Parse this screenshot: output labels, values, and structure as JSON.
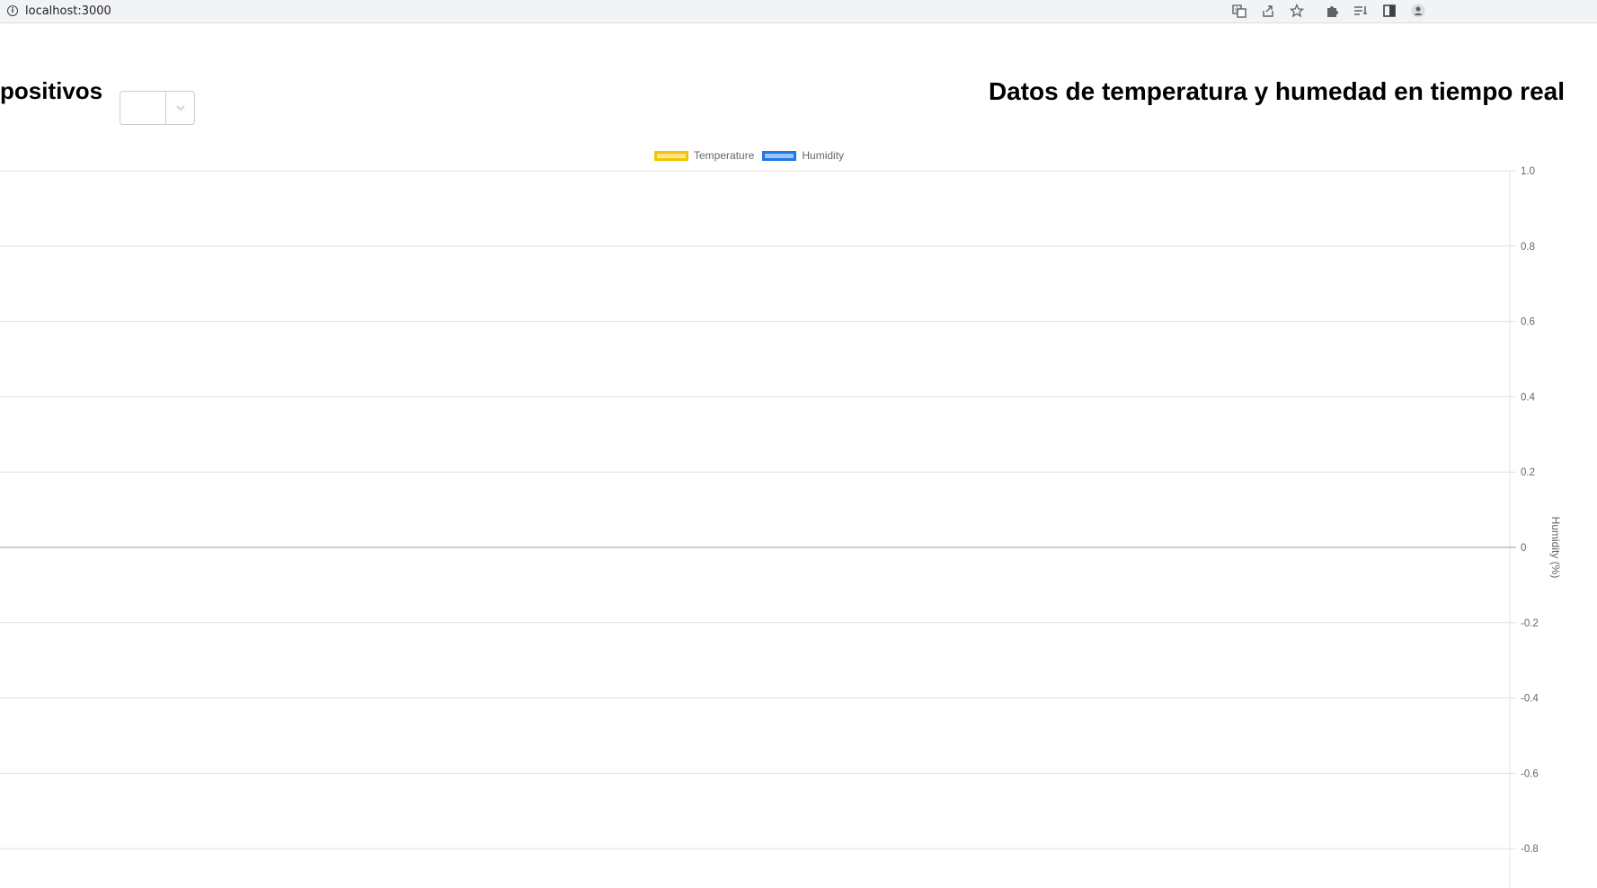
{
  "browser": {
    "url": "localhost:3000",
    "toolbar_icons": [
      "translate-icon",
      "share-icon",
      "bookmark-star-icon",
      "extensions-icon",
      "reading-list-icon",
      "side-panel-icon",
      "profile-icon"
    ]
  },
  "page": {
    "left_title": "positivos",
    "device_select_value": "",
    "right_title": "Datos de temperatura y humedad en tiempo real"
  },
  "chart_data": {
    "type": "line",
    "legend": {
      "position": "top",
      "entries": [
        {
          "name": "Temperature",
          "fill": "#ffe58a",
          "stroke": "#f5c400"
        },
        {
          "name": "Humidity",
          "fill": "#9cc4f5",
          "stroke": "#1e78e6"
        }
      ]
    },
    "series": [
      {
        "name": "Temperature",
        "values": []
      },
      {
        "name": "Humidity",
        "values": []
      }
    ],
    "y_right": {
      "label": "Humidity (%)",
      "ticks": [
        "1.0",
        "0.8",
        "0.6",
        "0.4",
        "0.2",
        "0",
        "-0.2",
        "-0.4",
        "-0.6",
        "-0.8"
      ],
      "ylim": [
        -1.0,
        1.0
      ]
    },
    "grid": true
  }
}
